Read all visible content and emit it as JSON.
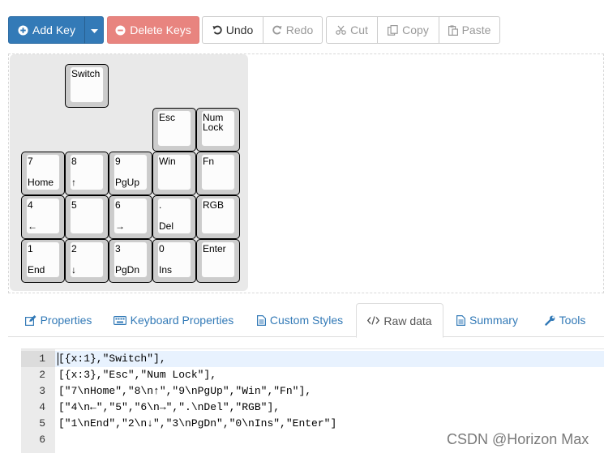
{
  "toolbar": {
    "add_key": "Add Key",
    "delete_keys": "Delete Keys",
    "undo": "Undo",
    "redo": "Redo",
    "cut": "Cut",
    "copy": "Copy",
    "paste": "Paste"
  },
  "keyboard": {
    "keys": [
      {
        "legend": [
          "Switch",
          ""
        ]
      },
      {
        "legend": [
          "Esc",
          ""
        ]
      },
      {
        "legend": [
          "Num\nLock",
          ""
        ]
      },
      {
        "legend": [
          "7",
          "Home"
        ]
      },
      {
        "legend": [
          "8",
          "↑"
        ]
      },
      {
        "legend": [
          "9",
          "PgUp"
        ]
      },
      {
        "legend": [
          "Win",
          ""
        ]
      },
      {
        "legend": [
          "Fn",
          ""
        ]
      },
      {
        "legend": [
          "4",
          "←"
        ]
      },
      {
        "legend": [
          "5",
          ""
        ]
      },
      {
        "legend": [
          "6",
          "→"
        ]
      },
      {
        "legend": [
          ".",
          "Del"
        ]
      },
      {
        "legend": [
          "RGB",
          ""
        ]
      },
      {
        "legend": [
          "1",
          "End"
        ]
      },
      {
        "legend": [
          "2",
          "↓"
        ]
      },
      {
        "legend": [
          "3",
          "PgDn"
        ]
      },
      {
        "legend": [
          "0",
          "Ins"
        ]
      },
      {
        "legend": [
          "Enter",
          ""
        ]
      }
    ]
  },
  "tabs": [
    {
      "label": "Properties",
      "icon": "edit-icon",
      "active": false
    },
    {
      "label": "Keyboard Properties",
      "icon": "keyboard-icon",
      "active": false
    },
    {
      "label": "Custom Styles",
      "icon": "file-text-icon",
      "active": false
    },
    {
      "label": "Raw data",
      "icon": "code-icon",
      "active": true
    },
    {
      "label": "Summary",
      "icon": "file-list-icon",
      "active": false
    },
    {
      "label": "Tools",
      "icon": "wrench-icon",
      "active": false
    }
  ],
  "editor": {
    "line_numbers": [
      "1",
      "2",
      "3",
      "4",
      "5",
      "6"
    ],
    "lines": [
      "[{x:1},\"Switch\"],",
      "[{x:3},\"Esc\",\"Num Lock\"],",
      "[\"7\\nHome\",\"8\\n↑\",\"9\\nPgUp\",\"Win\",\"Fn\"],",
      "[\"4\\n←\",\"5\",\"6\\n→\",\".\\nDel\",\"RGB\"],",
      "[\"1\\nEnd\",\"2\\n↓\",\"3\\nPgDn\",\"0\\nIns\",\"Enter\"]",
      ""
    ]
  },
  "watermark": "CSDN @Horizon Max",
  "colors": {
    "primary": "#337ab7",
    "danger": "#e8847f",
    "tab_link": "#337ab7",
    "editor_active_line": "#e8f2fe"
  }
}
